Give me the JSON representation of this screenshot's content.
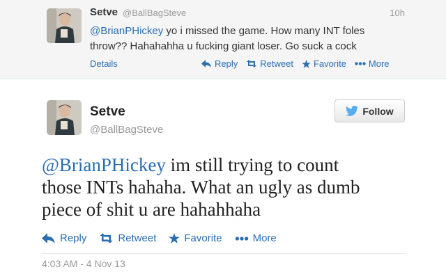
{
  "parent_tweet": {
    "name": "Setve",
    "handle": "@BallBagSteve",
    "time": "10h",
    "mention": "@BrianPHickey",
    "text_line1": " yo i missed the game. How many INT foles",
    "text_line2": "throw?? Hahahahha u fucking giant loser. Go suck a cock",
    "details_label": "Details",
    "actions": {
      "reply": "Reply",
      "retweet": "Retweet",
      "favorite": "Favorite",
      "more": "More"
    }
  },
  "main_tweet": {
    "name": "Setve",
    "handle": "@BallBagSteve",
    "follow_label": "Follow",
    "mention": "@BrianPHickey",
    "text_line1": " im still trying to count",
    "text_line2": "those INTs hahaha. What an ugly as dumb",
    "text_line3": "piece of shit u are hahahhaha",
    "actions": {
      "reply": "Reply",
      "retweet": "Retweet",
      "favorite": "Favorite",
      "more": "More"
    },
    "timestamp": "4:03 AM - 4 Nov 13"
  },
  "colors": {
    "link": "#2a6db0",
    "twitter_bird": "#55acee",
    "muted": "#999999"
  },
  "icons": [
    "reply-arrow-icon",
    "retweet-icon",
    "star-icon",
    "more-dots-icon",
    "twitter-bird-icon"
  ]
}
